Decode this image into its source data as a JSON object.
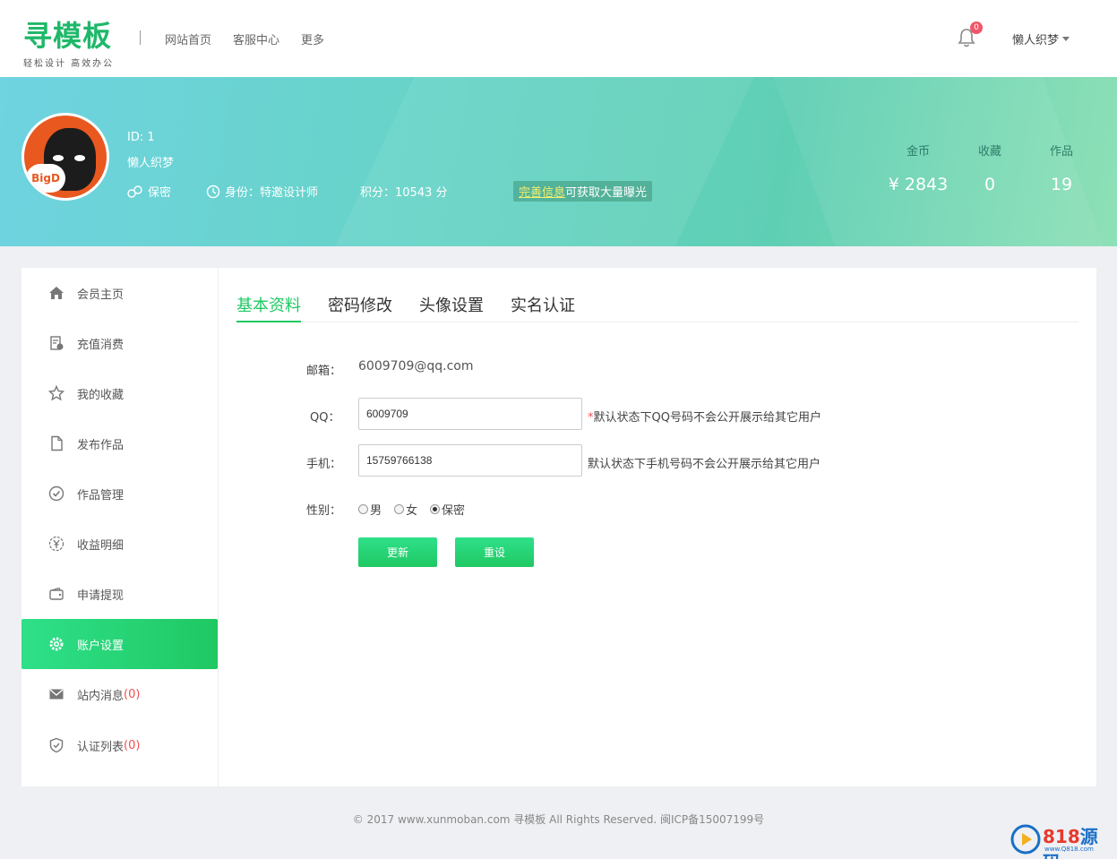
{
  "header": {
    "logo_main": "寻模板",
    "logo_sub": "轻松设计 高效办公",
    "nav": [
      "网站首页",
      "客服中心",
      "更多"
    ],
    "notify_count": "0",
    "username": "懒人织梦"
  },
  "banner": {
    "avatar_text": "BigD",
    "id_text": "ID: 1",
    "name": "懒人织梦",
    "gender": "保密",
    "identity": "身份：特邀设计师",
    "points": "积分：10543 分",
    "perfect_link": "完善信息",
    "perfect_tail": "可获取大量曝光",
    "stats": [
      {
        "label": "金币",
        "value": "¥ 2843"
      },
      {
        "label": "收藏",
        "value": "0"
      },
      {
        "label": "作品",
        "value": "19"
      }
    ]
  },
  "sidebar": {
    "items": [
      {
        "label": "会员主页",
        "icon": "home-icon"
      },
      {
        "label": "充值消费",
        "icon": "bill-icon"
      },
      {
        "label": "我的收藏",
        "icon": "star-icon"
      },
      {
        "label": "发布作品",
        "icon": "file-icon"
      },
      {
        "label": "作品管理",
        "icon": "check-circle-icon"
      },
      {
        "label": "收益明细",
        "icon": "yen-icon"
      },
      {
        "label": "申请提现",
        "icon": "wallet-icon"
      },
      {
        "label": "账户设置",
        "icon": "gear-icon"
      },
      {
        "label": "站内消息",
        "icon": "mail-icon",
        "count": "(0)"
      },
      {
        "label": "认证列表",
        "icon": "shield-icon",
        "count": "(0)"
      }
    ],
    "active_index": 7
  },
  "tabs": [
    "基本资料",
    "密码修改",
    "头像设置",
    "实名认证"
  ],
  "form": {
    "email_label": "邮箱：",
    "email_value": "6009709@qq.com",
    "qq_label": "QQ：",
    "qq_value": "6009709",
    "qq_hint_star": "*",
    "qq_hint": "默认状态下QQ号码不会公开展示给其它用户",
    "phone_label": "手机：",
    "phone_value": "15759766138",
    "phone_hint": "默认状态下手机号码不会公开展示给其它用户",
    "gender_label": "性别：",
    "gender_options": [
      "男",
      "女",
      "保密"
    ],
    "gender_selected": 2,
    "update_label": "更新",
    "reset_label": "重设"
  },
  "footer": "© 2017 www.xunmoban.com 寻模板 All Rights Reserved. 闽ICP备15007199号",
  "watermark": {
    "brand_num": "818",
    "brand_cn": "源码",
    "url": "www.Q818.com"
  },
  "colors": {
    "accent": "#1fc862",
    "badge": "#f0566a"
  }
}
